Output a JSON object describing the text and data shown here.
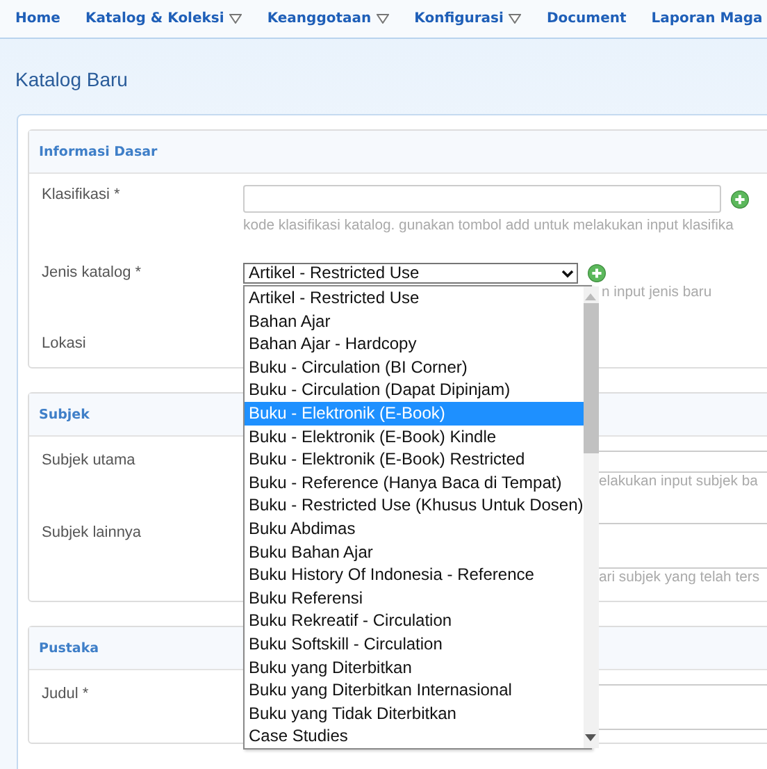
{
  "nav": [
    {
      "label": "Home",
      "has_menu": false
    },
    {
      "label": "Katalog & Koleksi",
      "has_menu": true
    },
    {
      "label": "Keanggotaan",
      "has_menu": true
    },
    {
      "label": "Konfigurasi",
      "has_menu": true
    },
    {
      "label": "Document",
      "has_menu": false
    },
    {
      "label": "Laporan Maga",
      "has_menu": false
    }
  ],
  "page_title": "Katalog Baru",
  "sections": [
    {
      "title": "Informasi Dasar",
      "fields": [
        {
          "kind": "input",
          "label": "Klasifikasi *",
          "add_button": true,
          "hint": "kode klasifikasi katalog. gunakan tombol add untuk melakukan input klasifika"
        },
        {
          "kind": "select",
          "label": "Jenis katalog *",
          "add_button": true,
          "value": "Artikel - Restricted Use",
          "hint": "n input jenis baru"
        },
        {
          "kind": "label",
          "label": "Lokasi"
        }
      ]
    },
    {
      "title": "Subjek",
      "fields": [
        {
          "kind": "covered-input",
          "label": "Subjek utama",
          "hint": "elakukan input subjek ba"
        },
        {
          "kind": "covered-textarea",
          "label": "Subjek lainnya",
          "hint": "ari subjek yang telah ters"
        }
      ]
    },
    {
      "title": "Pustaka",
      "fields": [
        {
          "kind": "covered-textarea",
          "label": "Judul *"
        }
      ]
    }
  ],
  "dropdown": {
    "options": [
      {
        "label": "Artikel - Restricted Use",
        "selected": false
      },
      {
        "label": "Bahan Ajar",
        "selected": false
      },
      {
        "label": "Bahan Ajar - Hardcopy",
        "selected": false
      },
      {
        "label": "Buku - Circulation (BI Corner)",
        "selected": false
      },
      {
        "label": "Buku - Circulation (Dapat Dipinjam)",
        "selected": false
      },
      {
        "label": "Buku - Elektronik (E-Book)",
        "selected": true
      },
      {
        "label": "Buku - Elektronik (E-Book) Kindle",
        "selected": false
      },
      {
        "label": "Buku - Elektronik (E-Book) Restricted",
        "selected": false
      },
      {
        "label": "Buku - Reference (Hanya Baca di Tempat)",
        "selected": false
      },
      {
        "label": "Buku - Restricted Use (Khusus Untuk Dosen)",
        "selected": false
      },
      {
        "label": "Buku Abdimas",
        "selected": false
      },
      {
        "label": "Buku Bahan Ajar",
        "selected": false
      },
      {
        "label": "Buku History Of Indonesia - Reference",
        "selected": false
      },
      {
        "label": "Buku Referensi",
        "selected": false
      },
      {
        "label": "Buku Rekreatif - Circulation",
        "selected": false
      },
      {
        "label": "Buku Softskill - Circulation",
        "selected": false
      },
      {
        "label": "Buku yang Diterbitkan",
        "selected": false
      },
      {
        "label": "Buku yang Diterbitkan Internasional",
        "selected": false
      },
      {
        "label": "Buku yang Tidak Diterbitkan",
        "selected": false
      },
      {
        "label": "Case Studies",
        "selected": false
      }
    ]
  }
}
